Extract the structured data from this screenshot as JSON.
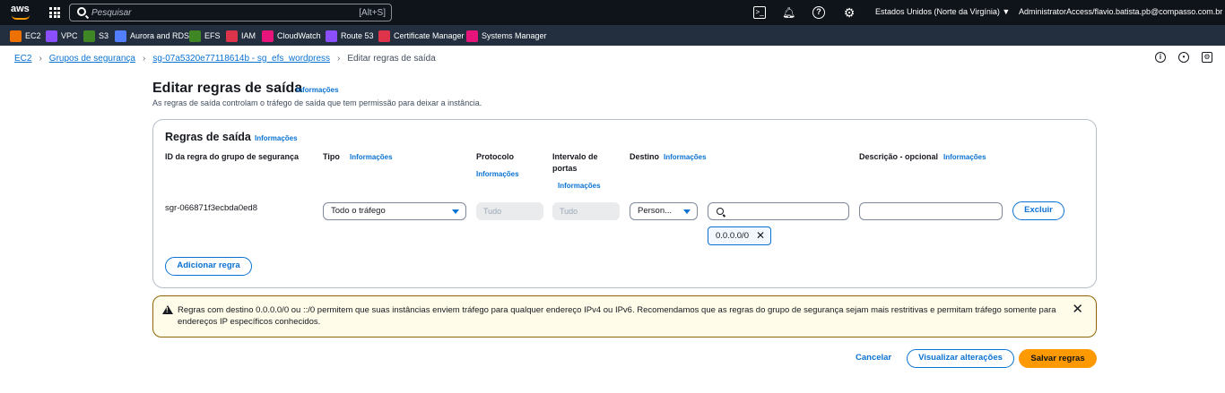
{
  "topbar": {
    "logo": "aws",
    "search_placeholder": "Pesquisar",
    "search_shortcut": "[Alt+S]",
    "region": "Estados Unidos (Norte da Virgínia) ▼",
    "account": "AdministratorAccess/flavio.batista.pb@compasso.com.br ▼"
  },
  "favorites": [
    {
      "label": "EC2",
      "color": "#ed7100"
    },
    {
      "label": "VPC",
      "color": "#8c4fff"
    },
    {
      "label": "S3",
      "color": "#3f8624"
    },
    {
      "label": "Aurora and RDS",
      "color": "#527fff"
    },
    {
      "label": "EFS",
      "color": "#3f8624"
    },
    {
      "label": "IAM",
      "color": "#dd344c"
    },
    {
      "label": "CloudWatch",
      "color": "#e7157b"
    },
    {
      "label": "Route 53",
      "color": "#8c4fff"
    },
    {
      "label": "Certificate Manager",
      "color": "#dd344c"
    },
    {
      "label": "Systems Manager",
      "color": "#e7157b"
    }
  ],
  "breadcrumb": {
    "items": [
      "EC2",
      "Grupos de segurança",
      "sg-07a5320e77118614b - sg_efs_wordpress"
    ],
    "current": "Editar regras de saída"
  },
  "page": {
    "title": "Editar regras de saída",
    "info": "Informações",
    "description": "As regras de saída controlam o tráfego de saída que tem permissão para deixar a instância."
  },
  "rules": {
    "title": "Regras de saída",
    "info": "Informações",
    "columns": {
      "id": "ID da regra do grupo de segurança",
      "type": "Tipo",
      "type_info": "Informações",
      "protocol": "Protocolo",
      "protocol_info": "Informações",
      "port_line1": "Intervalo de",
      "port_line2": "portas",
      "port_info": "Informações",
      "destination": "Destino",
      "destination_info": "Informações",
      "description": "Descrição - opcional",
      "description_info": "Informações"
    },
    "row": {
      "id": "sgr-066871f3ecbda0ed8",
      "type": "Todo o tráfego",
      "protocol_placeholder": "Tudo",
      "port_placeholder": "Tudo",
      "destination_mode": "Person...",
      "cidr_token": "0.0.0.0/0",
      "delete_label": "Excluir"
    },
    "add_label": "Adicionar regra"
  },
  "alert": {
    "text": "Regras com destino 0.0.0.0/0 ou ::/0 permitem que suas instâncias enviem tráfego para qualquer endereço IPv4 ou IPv6. Recomendamos que as regras do grupo de segurança sejam mais restritivas e permitam tráfego somente para endereços IP específicos conhecidos."
  },
  "actions": {
    "cancel": "Cancelar",
    "preview": "Visualizar alterações",
    "save": "Salvar regras"
  }
}
